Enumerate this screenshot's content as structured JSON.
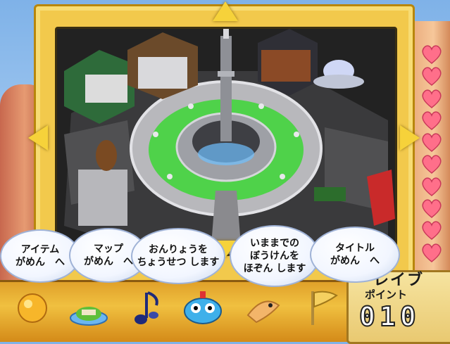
{
  "nav_arrows": {
    "up": "up-arrow-icon",
    "down": "down-arrow-icon",
    "left": "left-arrow-icon",
    "right": "right-arrow-icon"
  },
  "hearts": {
    "count": 10,
    "icon": "heart-icon",
    "color": "#ff6f8a"
  },
  "menu": [
    {
      "line1": "アイテム",
      "line2": "がめん　へ"
    },
    {
      "line1": "マップ",
      "line2": "がめん　へ"
    },
    {
      "line1": "おんりょうを",
      "line2": "ちょうせつ します"
    },
    {
      "line1": "いままでの",
      "line2": "ぼうけんを",
      "line3": "ほぞん します"
    },
    {
      "line1": "タイトル",
      "line2": "がめん　へ"
    }
  ],
  "toolbar_icons": [
    "sun-icon",
    "island-icon",
    "music-note-icon",
    "robot-face-icon",
    "bird-icon",
    "flag-icon"
  ],
  "save": {
    "title": "レイブ",
    "subtitle": "ポイント",
    "points": "010"
  },
  "colors": {
    "frame": "#f2c94c",
    "toolbar": "#e0a12a",
    "bubble_border": "#9fb2d6"
  }
}
